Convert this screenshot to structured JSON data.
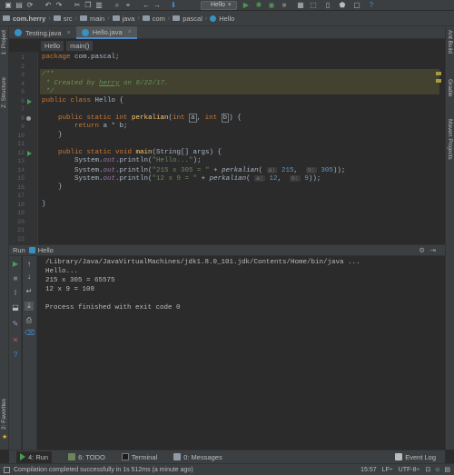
{
  "navbar": {
    "crumbs": [
      "com.herry",
      "src",
      "main",
      "java",
      "com",
      "pascal",
      "Hello"
    ]
  },
  "toolbar": {
    "run_config": "Hello"
  },
  "tabs": [
    {
      "label": "Testing.java",
      "active": false
    },
    {
      "label": "Hello.java",
      "active": true
    }
  ],
  "breadcrumb": {
    "class_name": "Hello",
    "method": "main()"
  },
  "left_strip": {
    "project": "1: Project",
    "structure": "Z: Structure",
    "favorites": "2: Favorites"
  },
  "right_strip": {
    "ant": "Ant Build",
    "gradle": "Gradle",
    "maven": "Maven Projects"
  },
  "editor": {
    "line_numbers": [
      "1",
      "2",
      "3",
      "4",
      "5",
      "6",
      "7",
      "8",
      "9",
      "10",
      "11",
      "12",
      "13",
      "14",
      "15",
      "16",
      "17",
      "18",
      "19",
      "20",
      "21",
      "22"
    ],
    "package_kw": "package",
    "package_name": "com.pascal;",
    "doc_open": "/**",
    "doc_created": " * Created by ",
    "doc_author": "herry",
    "doc_date": " on 6/22/17.",
    "doc_close": " */",
    "l6_kw": "public class",
    "l6_name": " Hello {",
    "l8_kw1": "public static int",
    "l8_fn": "perkalian",
    "l8_p1": "(",
    "l8_kw2": "int",
    "l8_a": "a",
    "l8_mid": ", ",
    "l8_kw3": "int",
    "l8_b": "b",
    "l8_end": ") {",
    "l9_kw": "return",
    "l9_rest": " a * b;",
    "l10": "}",
    "l12_kw": "public static void",
    "l12_fn": "main",
    "l12_rest": "(String[] args) {",
    "sys": "System.",
    "out": "out",
    "println": ".println(",
    "l13_str": "\"Hello...\"",
    "l13_end": ");",
    "l14_str": "\"215 x 305 = \"",
    "plus": " + ",
    "perk": "perkalian",
    "hint_a": "a:",
    "hint_b": "b:",
    "l14_n1": "215",
    "l14_n2": "305",
    "l14_end": "));",
    "l15_str": "\"12 x 9 = \"",
    "l15_n1": "12",
    "l15_n2": "9",
    "l15_end": "));",
    "l16": "}",
    "l18": "}",
    "comma": ", ",
    "open": "(",
    "close_p": ")"
  },
  "run": {
    "header_label": "Run",
    "config": "Hello",
    "console": [
      "/Library/Java/JavaVirtualMachines/jdk1.8.0_101.jdk/Contents/Home/bin/java ...",
      "Hello...",
      "215 x 305 = 65575",
      "12 x 9 = 108",
      "",
      "Process finished with exit code 0"
    ]
  },
  "bottom_tabs": {
    "run": "4: Run",
    "todo": "6: TODO",
    "terminal": "Terminal",
    "messages": "0: Messages",
    "event_log": "Event Log"
  },
  "status": {
    "message": "Compilation completed successfully in 1s 512ms (a minute ago)",
    "position": "15:57",
    "line_sep": "LF÷",
    "encoding": "UTF-8÷"
  },
  "colors": {
    "accent": "#4a88c7",
    "run_green": "#499c54",
    "keyword": "#cc7832",
    "string": "#6a8759",
    "number": "#6897bb",
    "method": "#ffc66d",
    "doc_comment": "#629755"
  }
}
